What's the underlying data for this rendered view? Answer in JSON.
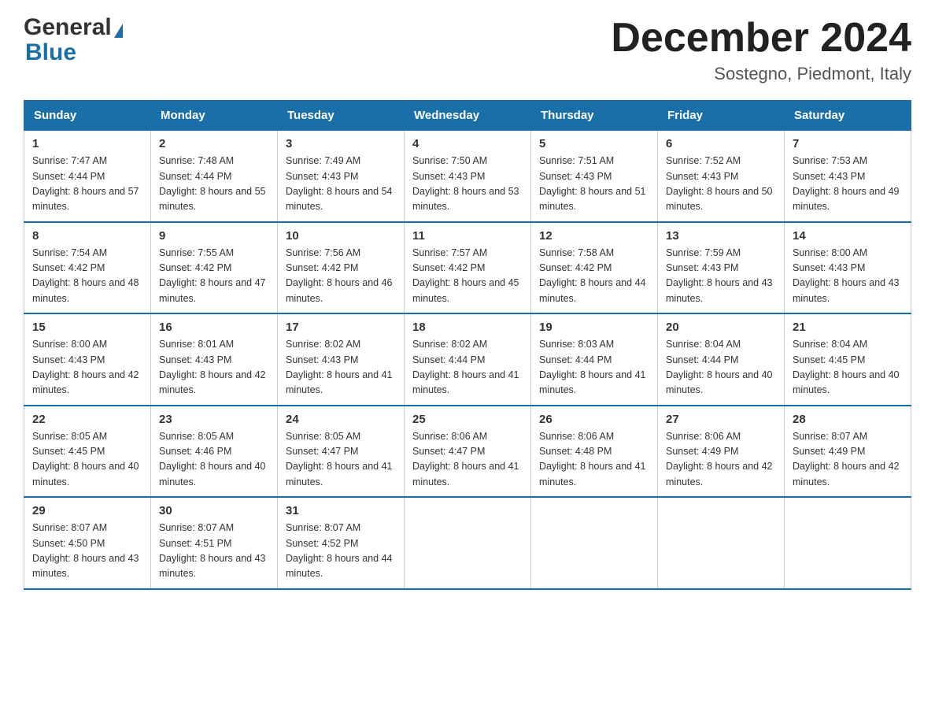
{
  "header": {
    "month_title": "December 2024",
    "location": "Sostegno, Piedmont, Italy",
    "logo_general": "General",
    "logo_blue": "Blue"
  },
  "days_of_week": [
    "Sunday",
    "Monday",
    "Tuesday",
    "Wednesday",
    "Thursday",
    "Friday",
    "Saturday"
  ],
  "weeks": [
    [
      {
        "day": "1",
        "sunrise": "7:47 AM",
        "sunset": "4:44 PM",
        "daylight": "8 hours and 57 minutes."
      },
      {
        "day": "2",
        "sunrise": "7:48 AM",
        "sunset": "4:44 PM",
        "daylight": "8 hours and 55 minutes."
      },
      {
        "day": "3",
        "sunrise": "7:49 AM",
        "sunset": "4:43 PM",
        "daylight": "8 hours and 54 minutes."
      },
      {
        "day": "4",
        "sunrise": "7:50 AM",
        "sunset": "4:43 PM",
        "daylight": "8 hours and 53 minutes."
      },
      {
        "day": "5",
        "sunrise": "7:51 AM",
        "sunset": "4:43 PM",
        "daylight": "8 hours and 51 minutes."
      },
      {
        "day": "6",
        "sunrise": "7:52 AM",
        "sunset": "4:43 PM",
        "daylight": "8 hours and 50 minutes."
      },
      {
        "day": "7",
        "sunrise": "7:53 AM",
        "sunset": "4:43 PM",
        "daylight": "8 hours and 49 minutes."
      }
    ],
    [
      {
        "day": "8",
        "sunrise": "7:54 AM",
        "sunset": "4:42 PM",
        "daylight": "8 hours and 48 minutes."
      },
      {
        "day": "9",
        "sunrise": "7:55 AM",
        "sunset": "4:42 PM",
        "daylight": "8 hours and 47 minutes."
      },
      {
        "day": "10",
        "sunrise": "7:56 AM",
        "sunset": "4:42 PM",
        "daylight": "8 hours and 46 minutes."
      },
      {
        "day": "11",
        "sunrise": "7:57 AM",
        "sunset": "4:42 PM",
        "daylight": "8 hours and 45 minutes."
      },
      {
        "day": "12",
        "sunrise": "7:58 AM",
        "sunset": "4:42 PM",
        "daylight": "8 hours and 44 minutes."
      },
      {
        "day": "13",
        "sunrise": "7:59 AM",
        "sunset": "4:43 PM",
        "daylight": "8 hours and 43 minutes."
      },
      {
        "day": "14",
        "sunrise": "8:00 AM",
        "sunset": "4:43 PM",
        "daylight": "8 hours and 43 minutes."
      }
    ],
    [
      {
        "day": "15",
        "sunrise": "8:00 AM",
        "sunset": "4:43 PM",
        "daylight": "8 hours and 42 minutes."
      },
      {
        "day": "16",
        "sunrise": "8:01 AM",
        "sunset": "4:43 PM",
        "daylight": "8 hours and 42 minutes."
      },
      {
        "day": "17",
        "sunrise": "8:02 AM",
        "sunset": "4:43 PM",
        "daylight": "8 hours and 41 minutes."
      },
      {
        "day": "18",
        "sunrise": "8:02 AM",
        "sunset": "4:44 PM",
        "daylight": "8 hours and 41 minutes."
      },
      {
        "day": "19",
        "sunrise": "8:03 AM",
        "sunset": "4:44 PM",
        "daylight": "8 hours and 41 minutes."
      },
      {
        "day": "20",
        "sunrise": "8:04 AM",
        "sunset": "4:44 PM",
        "daylight": "8 hours and 40 minutes."
      },
      {
        "day": "21",
        "sunrise": "8:04 AM",
        "sunset": "4:45 PM",
        "daylight": "8 hours and 40 minutes."
      }
    ],
    [
      {
        "day": "22",
        "sunrise": "8:05 AM",
        "sunset": "4:45 PM",
        "daylight": "8 hours and 40 minutes."
      },
      {
        "day": "23",
        "sunrise": "8:05 AM",
        "sunset": "4:46 PM",
        "daylight": "8 hours and 40 minutes."
      },
      {
        "day": "24",
        "sunrise": "8:05 AM",
        "sunset": "4:47 PM",
        "daylight": "8 hours and 41 minutes."
      },
      {
        "day": "25",
        "sunrise": "8:06 AM",
        "sunset": "4:47 PM",
        "daylight": "8 hours and 41 minutes."
      },
      {
        "day": "26",
        "sunrise": "8:06 AM",
        "sunset": "4:48 PM",
        "daylight": "8 hours and 41 minutes."
      },
      {
        "day": "27",
        "sunrise": "8:06 AM",
        "sunset": "4:49 PM",
        "daylight": "8 hours and 42 minutes."
      },
      {
        "day": "28",
        "sunrise": "8:07 AM",
        "sunset": "4:49 PM",
        "daylight": "8 hours and 42 minutes."
      }
    ],
    [
      {
        "day": "29",
        "sunrise": "8:07 AM",
        "sunset": "4:50 PM",
        "daylight": "8 hours and 43 minutes."
      },
      {
        "day": "30",
        "sunrise": "8:07 AM",
        "sunset": "4:51 PM",
        "daylight": "8 hours and 43 minutes."
      },
      {
        "day": "31",
        "sunrise": "8:07 AM",
        "sunset": "4:52 PM",
        "daylight": "8 hours and 44 minutes."
      },
      null,
      null,
      null,
      null
    ]
  ]
}
